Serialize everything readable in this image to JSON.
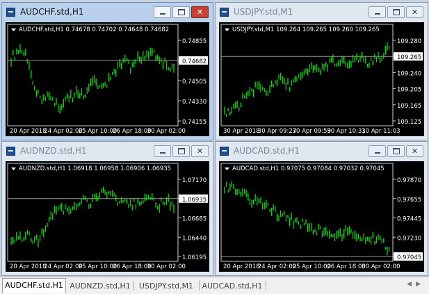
{
  "windows": [
    {
      "id": "audchf",
      "title": "AUDCHF.std,H1",
      "active": true,
      "chart": {
        "symbol_line": "AUDCHF.std,H1  0.74678 0.74702 0.74648 0.74682",
        "price_labels": [
          "0.74855",
          "0.74682",
          "0.74505",
          "0.74330",
          "0.74155"
        ],
        "time_labels": [
          "20 Apr 2018",
          "24 Apr 02:00",
          "25 Apr 10:00",
          "26 Apr 18:00",
          "30 Apr 02:00"
        ],
        "current_price": "0.74682"
      }
    },
    {
      "id": "usdjpy",
      "title": "USDJPY.std,M1",
      "active": false,
      "chart": {
        "symbol_line": "USDJPY.std,M1  109.264 109.265 109.260 109.265",
        "price_labels": [
          "109.280",
          "109.265",
          "109.240",
          "109.205",
          "109.165",
          "109.125"
        ],
        "time_labels": [
          "30 Apr 2018",
          "30 Apr 09:27",
          "30 Apr 09:59",
          "30 Apr 10:31",
          "30 Apr 11:03"
        ],
        "current_price": "109.265"
      }
    },
    {
      "id": "audnzd",
      "title": "AUDNZD.std,H1",
      "active": false,
      "chart": {
        "symbol_line": "AUDNZD.std,H1  1.06918 1.06958 1.06906 1.06935",
        "price_labels": [
          "1.07170",
          "1.06935",
          "1.06685",
          "1.06440",
          "1.06195"
        ],
        "time_labels": [
          "20 Apr 2018",
          "24 Apr 02:00",
          "25 Apr 10:00",
          "26 Apr 18:00",
          "30 Apr 02:00"
        ],
        "current_price": "1.06935"
      }
    },
    {
      "id": "audcad",
      "title": "AUDCAD.std,H1",
      "active": false,
      "chart": {
        "symbol_line": "AUDCAD.std,H1  0.97075 0.97084 0.97032 0.97045",
        "price_labels": [
          "0.97870",
          "0.97655",
          "0.97445",
          "0.97230",
          "0.97045"
        ],
        "time_labels": [
          "20 Apr 2018",
          "24 Apr 02:00",
          "25 Apr 10:00",
          "26 Apr 18:00",
          "30 Apr 02:00"
        ],
        "current_price": "0.97045"
      }
    }
  ],
  "tabs": [
    {
      "label": "AUDCHF.std,H1",
      "selected": true
    },
    {
      "label": "AUDNZD.std,H1",
      "selected": false
    },
    {
      "label": "USDJPY.std,M1",
      "selected": false
    },
    {
      "label": "AUDCAD.std,H1",
      "selected": false
    }
  ],
  "tab_arrows": {
    "left": "◀",
    "right": "▶"
  },
  "colors": {
    "candle": "#00e000",
    "axis": "#ffffff",
    "background": "#000000",
    "close_button": "#c84136"
  },
  "icons": {
    "minimize": "minimize-icon",
    "maximize": "maximize-icon",
    "close": "close-icon",
    "dropdown": "triangle-down-icon"
  }
}
